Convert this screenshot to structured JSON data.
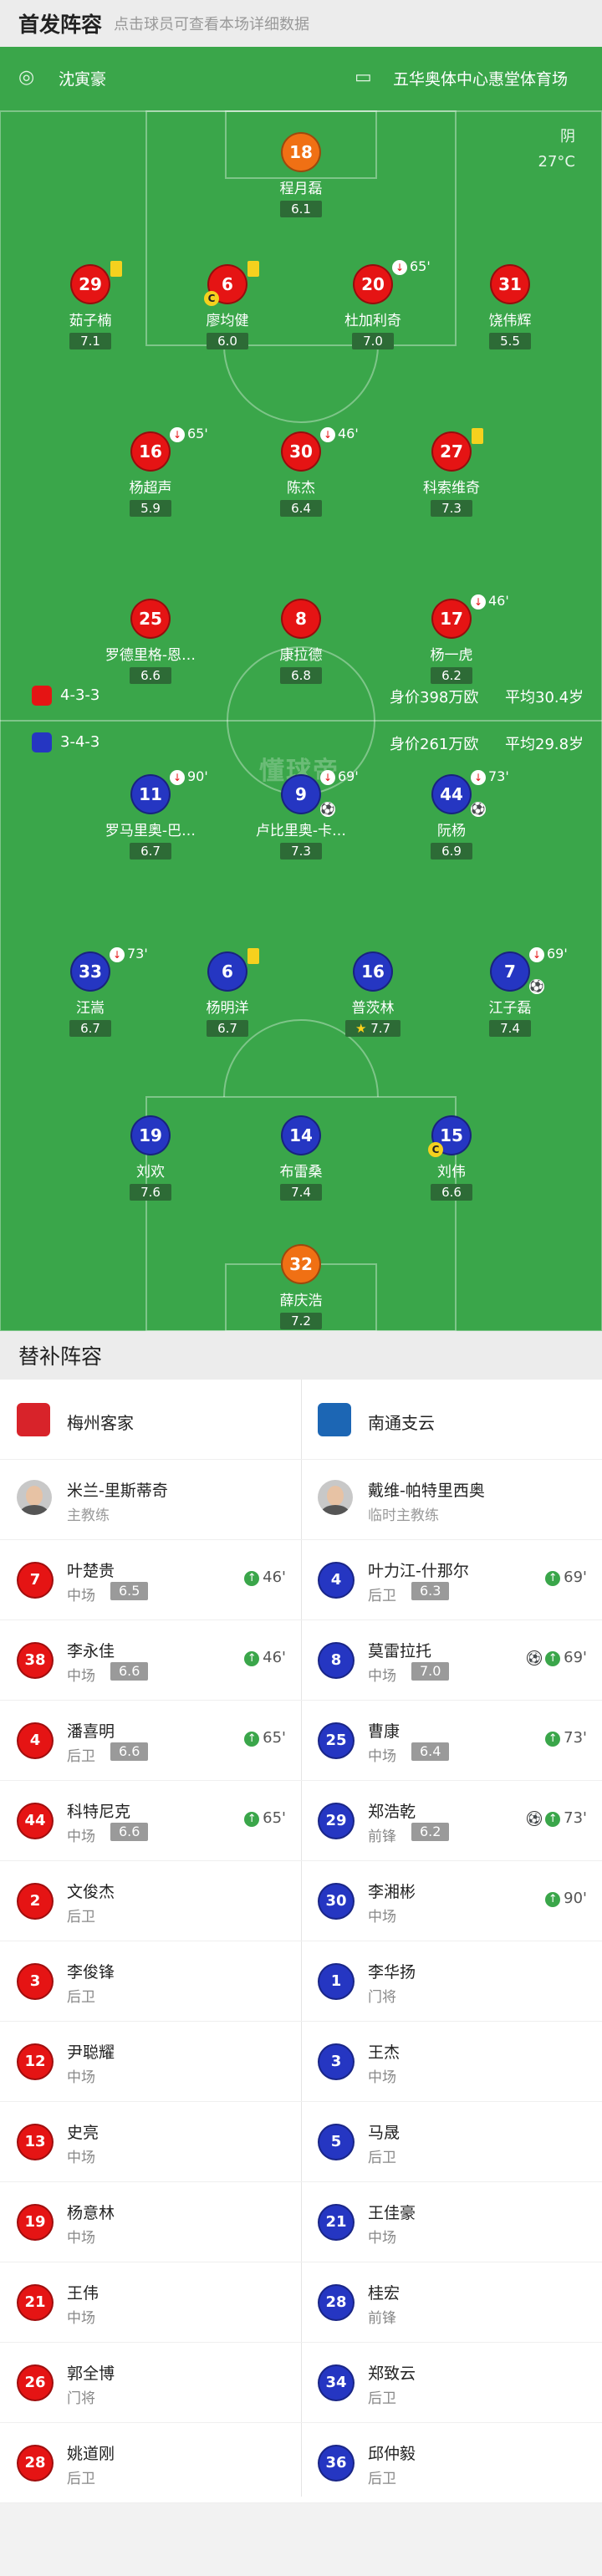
{
  "header": {
    "title": "首发阵容",
    "subtitle": "点击球员可查看本场详细数据"
  },
  "match": {
    "home_coach_label": "沈寅豪",
    "venue": "五华奥体中心惠堂体育场",
    "weather": "阴",
    "temperature": "27°C"
  },
  "home_team": {
    "formation": "4-3-3",
    "market_value": "身价398万欧",
    "avg_age": "平均30.4岁",
    "color": "#e51414"
  },
  "away_team": {
    "formation": "3-4-3",
    "market_value": "身价261万欧",
    "avg_age": "平均29.8岁",
    "color": "#2536c2"
  },
  "pitch_home": [
    {
      "number": "18",
      "name": "程月磊",
      "rating": "6.1",
      "color": "orange"
    },
    {
      "number": "29",
      "name": "茹子楠",
      "rating": "7.1",
      "color": "red",
      "yellow": true
    },
    {
      "number": "6",
      "name": "廖均健",
      "rating": "6.0",
      "color": "red",
      "yellow": true,
      "captain": true
    },
    {
      "number": "20",
      "name": "杜加利奇",
      "rating": "7.0",
      "color": "red",
      "sub_off": "65'"
    },
    {
      "number": "31",
      "name": "饶伟辉",
      "rating": "5.5",
      "color": "red"
    },
    {
      "number": "16",
      "name": "杨超声",
      "rating": "5.9",
      "color": "red",
      "sub_off": "65'"
    },
    {
      "number": "30",
      "name": "陈杰",
      "rating": "6.4",
      "color": "red",
      "sub_off": "46'"
    },
    {
      "number": "27",
      "name": "科索维奇",
      "rating": "7.3",
      "color": "red",
      "yellow": true
    },
    {
      "number": "25",
      "name": "罗德里格-恩…",
      "rating": "6.6",
      "color": "red"
    },
    {
      "number": "8",
      "name": "康拉德",
      "rating": "6.8",
      "color": "red"
    },
    {
      "number": "17",
      "name": "杨一虎",
      "rating": "6.2",
      "color": "red",
      "sub_off": "46'"
    }
  ],
  "pitch_away": [
    {
      "number": "11",
      "name": "罗马里奥-巴…",
      "rating": "6.7",
      "color": "blue",
      "sub_off": "90'"
    },
    {
      "number": "9",
      "name": "卢比里奥-卡…",
      "rating": "7.3",
      "color": "blue",
      "sub_off": "69'",
      "goal": true
    },
    {
      "number": "44",
      "name": "阮杨",
      "rating": "6.9",
      "color": "blue",
      "sub_off": "73'",
      "assist": true
    },
    {
      "number": "33",
      "name": "汪嵩",
      "rating": "6.7",
      "color": "blue",
      "sub_off": "73'"
    },
    {
      "number": "6",
      "name": "杨明洋",
      "rating": "6.7",
      "color": "blue",
      "yellow": true
    },
    {
      "number": "16",
      "name": "普茨林",
      "rating": "7.7",
      "color": "blue",
      "star": true
    },
    {
      "number": "7",
      "name": "江子磊",
      "rating": "7.4",
      "color": "blue",
      "sub_off": "69'",
      "goal": true
    },
    {
      "number": "19",
      "name": "刘欢",
      "rating": "7.6",
      "color": "blue"
    },
    {
      "number": "14",
      "name": "布雷桑",
      "rating": "7.4",
      "color": "blue"
    },
    {
      "number": "15",
      "name": "刘伟",
      "rating": "6.6",
      "color": "blue",
      "captain": true
    },
    {
      "number": "32",
      "name": "薛庆浩",
      "rating": "7.2",
      "color": "orange"
    }
  ],
  "icons": {
    "captain": "C",
    "star": "★",
    "ball": "⚽",
    "sub_off": "↓",
    "sub_on": "↑"
  },
  "watermark": "懂球帝",
  "subs": {
    "title": "替补阵容",
    "home_team_name": "梅州客家",
    "away_team_name": "南通支云",
    "home_coach": {
      "name": "米兰-里斯蒂奇",
      "role": "主教练"
    },
    "away_coach": {
      "name": "戴维-帕特里西奥",
      "role": "临时主教练"
    },
    "rows": [
      {
        "h": {
          "number": "7",
          "name": "叶楚贵",
          "pos": "中场",
          "rating": "6.5",
          "on": "46'"
        },
        "a": {
          "number": "4",
          "name": "叶力江-什那尔",
          "pos": "后卫",
          "rating": "6.3",
          "on": "69'"
        }
      },
      {
        "h": {
          "number": "38",
          "name": "李永佳",
          "pos": "中场",
          "rating": "6.6",
          "on": "46'"
        },
        "a": {
          "number": "8",
          "name": "莫雷拉托",
          "pos": "中场",
          "rating": "7.0",
          "on": "69'",
          "goal": true
        }
      },
      {
        "h": {
          "number": "4",
          "name": "潘喜明",
          "pos": "后卫",
          "rating": "6.6",
          "on": "65'"
        },
        "a": {
          "number": "25",
          "name": "曹康",
          "pos": "中场",
          "rating": "6.4",
          "on": "73'"
        }
      },
      {
        "h": {
          "number": "44",
          "name": "科特尼克",
          "pos": "中场",
          "rating": "6.6",
          "on": "65'"
        },
        "a": {
          "number": "29",
          "name": "郑浩乾",
          "pos": "前锋",
          "rating": "6.2",
          "on": "73'",
          "goal": true
        }
      },
      {
        "h": {
          "number": "2",
          "name": "文俊杰",
          "pos": "后卫"
        },
        "a": {
          "number": "30",
          "name": "李湘彬",
          "pos": "中场",
          "on": "90'"
        }
      },
      {
        "h": {
          "number": "3",
          "name": "李俊锋",
          "pos": "后卫"
        },
        "a": {
          "number": "1",
          "name": "李华扬",
          "pos": "门将"
        }
      },
      {
        "h": {
          "number": "12",
          "name": "尹聪耀",
          "pos": "中场"
        },
        "a": {
          "number": "3",
          "name": "王杰",
          "pos": "中场"
        }
      },
      {
        "h": {
          "number": "13",
          "name": "史亮",
          "pos": "中场"
        },
        "a": {
          "number": "5",
          "name": "马晟",
          "pos": "后卫"
        }
      },
      {
        "h": {
          "number": "19",
          "name": "杨意林",
          "pos": "中场"
        },
        "a": {
          "number": "21",
          "name": "王佳豪",
          "pos": "中场"
        }
      },
      {
        "h": {
          "number": "21",
          "name": "王伟",
          "pos": "中场"
        },
        "a": {
          "number": "28",
          "name": "桂宏",
          "pos": "前锋"
        }
      },
      {
        "h": {
          "number": "26",
          "name": "郭全博",
          "pos": "门将"
        },
        "a": {
          "number": "34",
          "name": "郑致云",
          "pos": "后卫"
        }
      },
      {
        "h": {
          "number": "28",
          "name": "姚道刚",
          "pos": "后卫"
        },
        "a": {
          "number": "36",
          "name": "邱仲毅",
          "pos": "后卫"
        }
      }
    ]
  }
}
